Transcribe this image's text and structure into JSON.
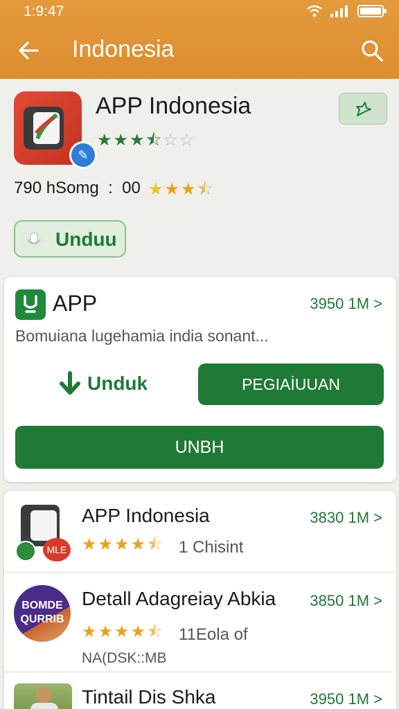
{
  "status": {
    "time": "1:9:47"
  },
  "appbar": {
    "title": "Indonesia",
    "back_icon": "back-arrow-icon",
    "search_icon": "search-icon"
  },
  "header": {
    "app_name": "APP Indonesia",
    "rating": 3.5,
    "stats_text": "790 hSomg  :  00",
    "stats_rating": 3.5,
    "install_label": "Unduu"
  },
  "featured": {
    "title": "APP",
    "size": "3950 1M >",
    "description": "Bomuiana lugehamia india sonant...",
    "download_label": "Unduk",
    "secondary_label": "PEGIAİUUAN",
    "primary_label": "UNBH"
  },
  "list": [
    {
      "title": "APP Indonesia",
      "size": "3830 1M >",
      "rating": 4.5,
      "meta": "1 Chisint",
      "icon_badge": "MLE"
    },
    {
      "title": "Detall Adagreiay  Abkia",
      "size": "3850 1M >",
      "rating": 4.5,
      "meta": "11Eola of",
      "sub": "NA(DSK::MB",
      "icon_text_1": "BOMDE",
      "icon_text_2": "QURRIB"
    },
    {
      "title": "Tintail Dis Shka",
      "size": "3950 1M >"
    }
  ],
  "colors": {
    "appbar": "#e0922f",
    "primary_green": "#1f7a35",
    "star_gold": "#e9a21a"
  }
}
